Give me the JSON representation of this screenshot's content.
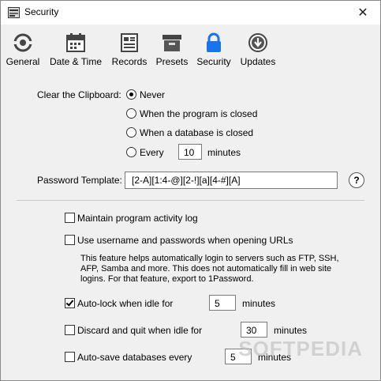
{
  "window": {
    "title": "Security",
    "close_glyph": "✕"
  },
  "toolbar": {
    "items": [
      {
        "label": "General",
        "icon": "general-icon"
      },
      {
        "label": "Date & Time",
        "icon": "calendar-icon"
      },
      {
        "label": "Records",
        "icon": "records-icon"
      },
      {
        "label": "Presets",
        "icon": "presets-icon"
      },
      {
        "label": "Security",
        "icon": "lock-icon",
        "active": true
      },
      {
        "label": "Updates",
        "icon": "download-icon"
      }
    ],
    "accent": "#1a73e8"
  },
  "clipboard": {
    "label": "Clear the Clipboard:",
    "options": [
      {
        "label": "Never",
        "selected": true
      },
      {
        "label": "When the program is closed",
        "selected": false
      },
      {
        "label": "When a database is closed",
        "selected": false
      },
      {
        "label": "Every",
        "selected": false
      }
    ],
    "every_value": "10",
    "every_unit": "minutes"
  },
  "password_template": {
    "label": "Password Template:",
    "value": "[2-A][1:4-@][2-!][a][4-#][A]",
    "help": "?"
  },
  "options": {
    "activity_log": {
      "label": "Maintain program activity log",
      "checked": false
    },
    "urls": {
      "label": "Use username and passwords when opening URLs",
      "checked": false
    },
    "urls_desc_1": "This feature helps automatically login to servers such as FTP, SSH,",
    "urls_desc_2": "AFP, Samba and more. This does not automatically fill in web site",
    "urls_desc_3": "logins. For that feature, export to 1Password.",
    "autolock": {
      "label": "Auto-lock when idle for",
      "checked": true,
      "value": "5",
      "unit": "minutes"
    },
    "discard": {
      "label": "Discard and quit when idle for",
      "checked": false,
      "value": "30",
      "unit": "minutes"
    },
    "autosave": {
      "label": "Auto-save databases every",
      "checked": false,
      "value": "5",
      "unit": "minutes"
    }
  },
  "watermark": "SOFTPEDIA"
}
